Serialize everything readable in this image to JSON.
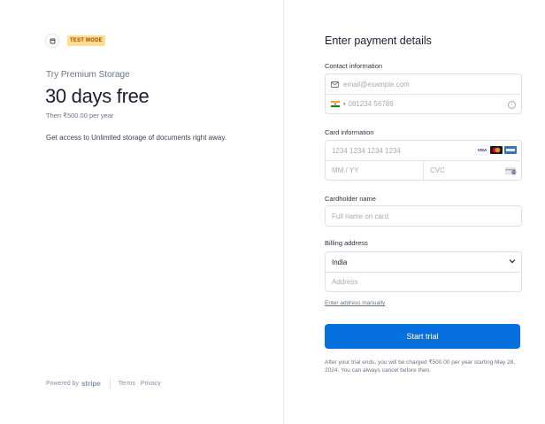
{
  "left": {
    "test_mode_badge": "TEST MODE",
    "product_name": "Try Premium Storage",
    "price_headline": "30 days free",
    "price_then": "Then ₹500.00 per year",
    "description": "Get access to Unlimited storage of documents right away.",
    "footer": {
      "powered_by": "Powered by",
      "brand": "stripe",
      "terms": "Terms",
      "privacy": "Privacy"
    }
  },
  "form": {
    "heading": "Enter payment details",
    "contact_label": "Contact information",
    "email_placeholder": "email@example.com",
    "phone_placeholder": "081234 56789",
    "card_label": "Card information",
    "card_number_placeholder": "1234 1234 1234 1234",
    "expiry_placeholder": "MM / YY",
    "cvc_placeholder": "CVC",
    "card_brands": [
      "VISA",
      "mastercard",
      "amex"
    ],
    "cardholder_label": "Cardholder name",
    "cardholder_placeholder": "Full name on card",
    "billing_label": "Billing address",
    "country_value": "India",
    "address_placeholder": "Address",
    "manual_link": "Enter address manually",
    "submit_label": "Start trial",
    "terms_text": "After your trial ends, you will be charged ₹500.00 per year starting May 28, 2024. You can always cancel before then."
  },
  "colors": {
    "accent": "#0570de",
    "test_badge_bg": "#ffde92",
    "test_badge_text": "#a04800"
  }
}
